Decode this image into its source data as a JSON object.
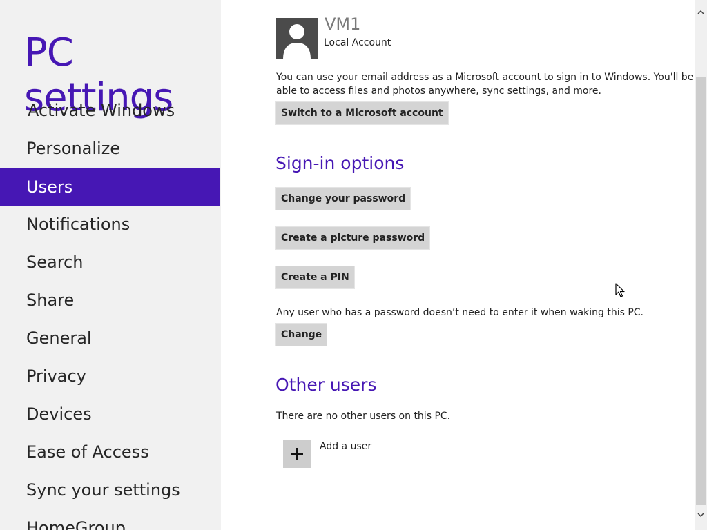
{
  "sidebar": {
    "title": "PC settings",
    "items": [
      {
        "label": "Activate Windows",
        "selected": false
      },
      {
        "label": "Personalize",
        "selected": false
      },
      {
        "label": "Users",
        "selected": true
      },
      {
        "label": "Notifications",
        "selected": false
      },
      {
        "label": "Search",
        "selected": false
      },
      {
        "label": "Share",
        "selected": false
      },
      {
        "label": "General",
        "selected": false
      },
      {
        "label": "Privacy",
        "selected": false
      },
      {
        "label": "Devices",
        "selected": false
      },
      {
        "label": "Ease of Access",
        "selected": false
      },
      {
        "label": "Sync your settings",
        "selected": false
      },
      {
        "label": "HomeGroup",
        "selected": false
      }
    ]
  },
  "account": {
    "name": "VM1",
    "type": "Local Account",
    "description": "You can use your email address as a Microsoft account to sign in to Windows. You'll be able to access files and photos anywhere, sync settings, and more.",
    "switch_button": "Switch to a Microsoft account"
  },
  "signin": {
    "heading": "Sign-in options",
    "change_password": "Change your password",
    "picture_password": "Create a picture password",
    "create_pin": "Create a PIN",
    "wake_text": "Any user who has a password doesn’t need to enter it when waking this PC.",
    "change_button": "Change"
  },
  "other_users": {
    "heading": "Other users",
    "empty_text": "There are no other users on this PC.",
    "add_user": "Add a user"
  },
  "colors": {
    "accent": "#4617b4",
    "sidebar_bg": "#f1f1f1",
    "button_bg": "#d4d4d4"
  },
  "icons": {
    "avatar": "user-silhouette-icon",
    "add": "plus-icon",
    "scroll_up": "chevron-up-icon",
    "scroll_down": "chevron-down-icon",
    "cursor": "mouse-pointer-icon"
  }
}
